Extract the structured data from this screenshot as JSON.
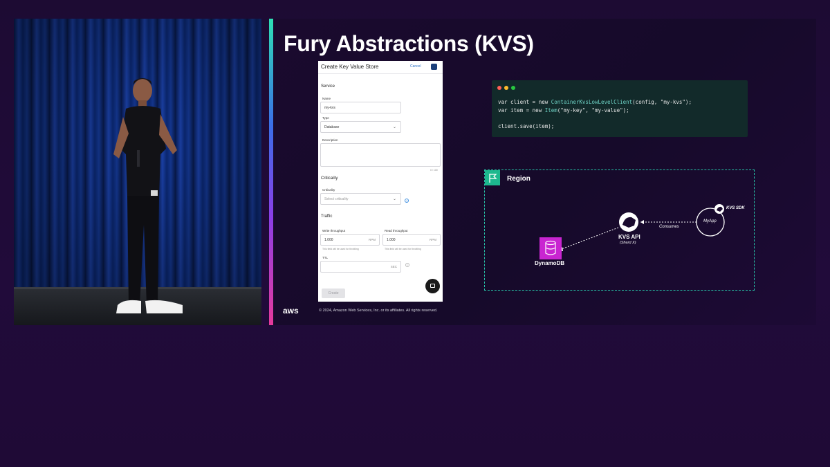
{
  "slide": {
    "title": "Fury Abstractions (KVS)",
    "aws_logo": "aws",
    "copyright": "© 2024, Amazon Web Services, Inc. or its affiliates. All rights reserved."
  },
  "form": {
    "header_title": "Create Key Value Store",
    "cancel_label": "Cancel",
    "section_service": "Service",
    "name_label": "Name",
    "name_value": "my-kvs",
    "type_label": "Type",
    "type_value": "Database",
    "description_label": "Description",
    "description_counter": "0 / 100",
    "section_criticality": "Criticality",
    "criticality_label": "Criticality",
    "criticality_placeholder": "Select criticality",
    "section_traffic": "Traffic",
    "write_label": "Write throughput",
    "write_value": "1.000",
    "write_unit": "RPM",
    "write_hint": "This field will be used for throttling",
    "read_label": "Read throughput",
    "read_value": "1.000",
    "read_unit": "RPM",
    "read_hint": "This field will be used for throttling",
    "ttl_label": "TTL",
    "ttl_unit": "SEC",
    "create_label": "Create"
  },
  "code": {
    "line1_a": "var client = new ",
    "line1_type": "ContainerKvsLowLevelClient",
    "line1_b": "(config, \"my-kvs\");",
    "line2_a": "var item = new ",
    "line2_type": "Item",
    "line2_b": "(\"my-key\", \"my-value\");",
    "line3": "client.save(item);",
    "dot_colors": [
      "#ff5f57",
      "#febc2e",
      "#28c840"
    ]
  },
  "diagram": {
    "region_label": "Region",
    "kvs_sdk_label": "KVS SDK",
    "myapp_label": "MyApp",
    "consumes_label": "Consumes",
    "kvs_api_label": "KVS API",
    "kvs_api_sub": "(Shard X)",
    "dynamodb_label": "DynamoDB",
    "accent": "#27c3a8",
    "dynamodb_color": "#c925d1"
  }
}
